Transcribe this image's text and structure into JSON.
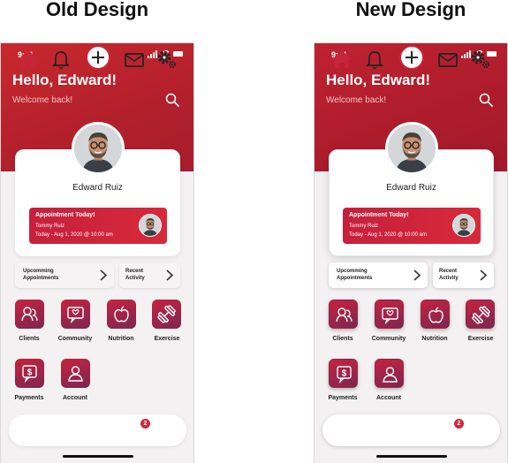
{
  "designs": [
    {
      "label": "Old Design",
      "status_time": "9:41",
      "greeting": "Hello, Edward!",
      "subtitle": "Welcome back!",
      "user_name": "Edward Ruiz",
      "appointment": {
        "title": "Appointment Today!",
        "person": "Tommy Ruiz",
        "datetime": "Today - Aug 1, 2020 @ 10:00 am"
      },
      "quick_links": [
        {
          "label": "Upcomming Appointments",
          "icon": "chevron-right-icon"
        },
        {
          "label": "Recent Activity",
          "icon": "chevron-right-icon"
        }
      ],
      "tiles": [
        {
          "label": "Clients",
          "icon": "clients-icon"
        },
        {
          "label": "Community",
          "icon": "community-icon"
        },
        {
          "label": "Nutrition",
          "icon": "apple-icon"
        },
        {
          "label": "Exercise",
          "icon": "dumbbell-icon"
        },
        {
          "label": "Payments",
          "icon": "payments-icon"
        },
        {
          "label": "Account",
          "icon": "account-icon"
        }
      ],
      "tabbar": {
        "items": [
          "home-icon",
          "bell-icon",
          "add-icon",
          "mail-icon",
          "settings-icon"
        ],
        "mail_badge": "2"
      }
    },
    {
      "label": "New Design",
      "status_time": "9:41",
      "greeting": "Hello, Edward!",
      "subtitle": "Welcome back!",
      "user_name": "Edward Ruiz",
      "appointment": {
        "title": "Appointment Today!",
        "person": "Tommy Ruiz",
        "datetime": "Today - Aug 1, 2020 @ 10:00 am"
      },
      "quick_links": [
        {
          "label": "Upcomming Appointments",
          "icon": "chevron-right-icon"
        },
        {
          "label": "Recent Activity",
          "icon": "chevron-right-icon"
        }
      ],
      "tiles": [
        {
          "label": "Clients",
          "icon": "clients-icon"
        },
        {
          "label": "Community",
          "icon": "community-icon"
        },
        {
          "label": "Nutrition",
          "icon": "apple-icon"
        },
        {
          "label": "Exercise",
          "icon": "dumbbell-icon"
        },
        {
          "label": "Payments",
          "icon": "payments-icon"
        },
        {
          "label": "Account",
          "icon": "account-icon"
        }
      ],
      "tabbar": {
        "items": [
          "home-icon",
          "bell-icon",
          "add-icon",
          "mail-icon",
          "settings-icon"
        ],
        "mail_badge": "2"
      }
    }
  ],
  "colors": {
    "brand_red": "#b2202c",
    "tile_gradient_start": "#c7223e",
    "tile_gradient_end": "#7b2752",
    "badge": "#d3263a"
  }
}
